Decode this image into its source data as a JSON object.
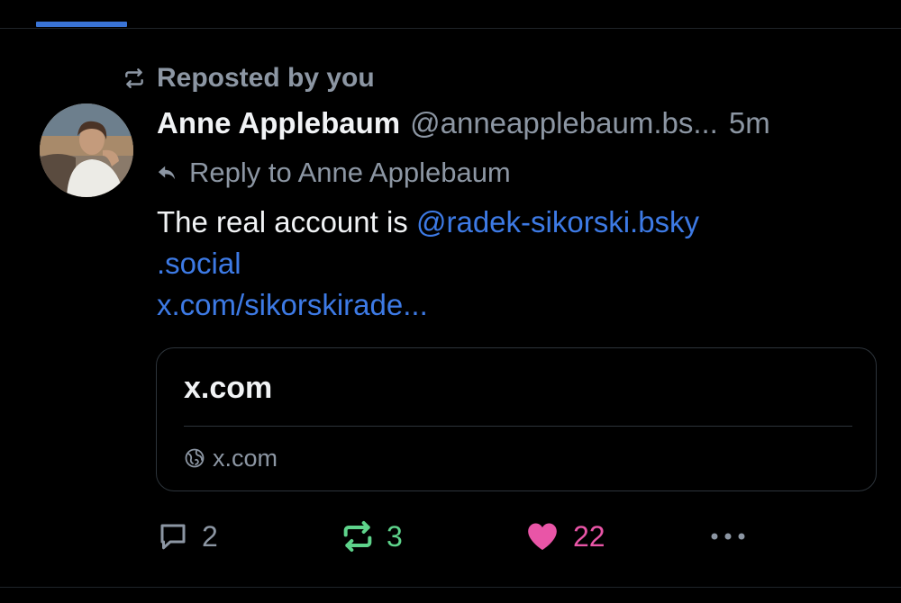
{
  "colors": {
    "background": "#000000",
    "accent": "#3a74d6",
    "link": "#3d7ae5",
    "muted": "#8c96a3",
    "text": "#f1f3f5",
    "repost_active": "#5ed38b",
    "like_active": "#e955a7"
  },
  "repost_context": {
    "icon": "repost-icon",
    "text": "Reposted by you"
  },
  "post": {
    "author_name": "Anne Applebaum",
    "author_handle": "@anneapplebaum.bs...",
    "time": "5m",
    "reply_to": "Reply to Anne Applebaum",
    "body": {
      "prefix": "The real account is ",
      "mention_part1": "@radek-sikorski.bsky",
      "mention_part2": ".social",
      "url": "x.com/sikorskirade..."
    },
    "embed": {
      "title": "x.com",
      "domain": "x.com",
      "domain_icon": "globe-icon"
    },
    "actions": {
      "reply_count": "2",
      "repost_count": "3",
      "like_count": "22"
    }
  }
}
